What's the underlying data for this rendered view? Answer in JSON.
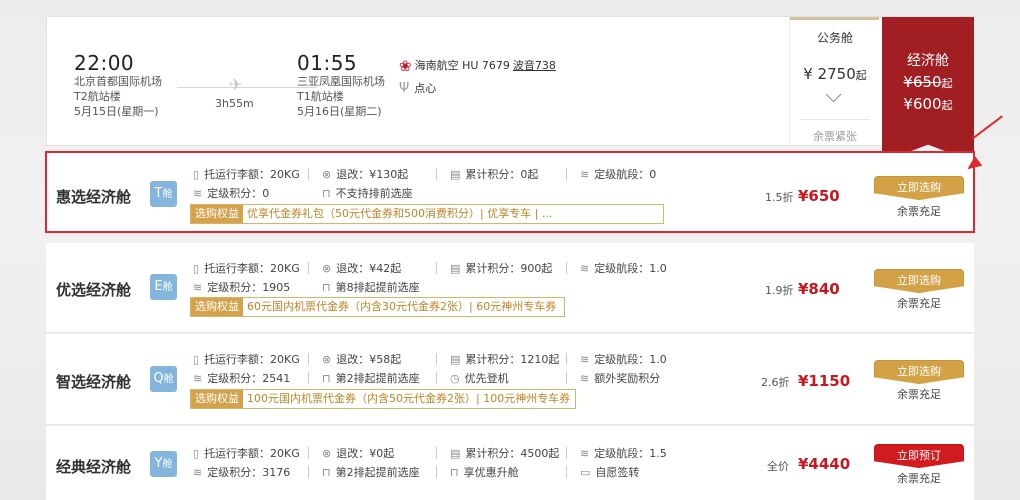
{
  "flight": {
    "dep_time": "22:00",
    "dep_airport": "北京首都国际机场",
    "dep_terminal": "T2航站楼",
    "dep_date": "5月15日(星期一)",
    "duration": "3h55m",
    "arr_time": "01:55",
    "arr_airport": "三亚凤凰国际机场",
    "arr_terminal": "T1航站楼",
    "arr_date": "5月16日(星期二)",
    "airline": "海南航空 HU 7679",
    "aircraft": "波音738",
    "meal": "点心"
  },
  "business": {
    "cabin": "公务舱",
    "price": "¥ 2750",
    "price_suffix": "起",
    "tickets": "余票紧张"
  },
  "economy": {
    "cabin": "经济舱",
    "old_price": "¥650",
    "new_price": "¥600",
    "price_suffix": "起"
  },
  "fares": [
    {
      "name": "惠选经济舱",
      "cls": "T",
      "cls_suffix": "舱",
      "baggage": "托运行李额：20KG",
      "change": "退改：¥130起",
      "points": "累计积分：0起",
      "segments": "定级航段：0",
      "level_points": "定级积分：0",
      "extra1": "不支持排前选座",
      "extra2": "",
      "extra3": "",
      "perk_tag": "选购权益",
      "perk": "优享代金券礼包（50元代金券和500消费积分）| 优享专车 | ...",
      "discount": "1.5折",
      "price": "¥650",
      "button": "立即选购",
      "seats": "余票充足"
    },
    {
      "name": "优选经济舱",
      "cls": "E",
      "cls_suffix": "舱",
      "baggage": "托运行李额：20KG",
      "change": "退改：¥42起",
      "points": "累计积分：900起",
      "segments": "定级航段：1.0",
      "level_points": "定级积分：1905",
      "extra1": "第8排起提前选座",
      "extra2": "",
      "extra3": "",
      "perk_tag": "选购权益",
      "perk": "60元国内机票代金券（内含30元代金券2张）| 60元神州专车券",
      "discount": "1.9折",
      "price": "¥840",
      "button": "立即选购",
      "seats": "余票充足"
    },
    {
      "name": "智选经济舱",
      "cls": "Q",
      "cls_suffix": "舱",
      "baggage": "托运行李额：20KG",
      "change": "退改：¥58起",
      "points": "累计积分：1210起",
      "segments": "定级航段：1.0",
      "level_points": "定级积分：2541",
      "extra1": "第2排起提前选座",
      "extra2": "优先登机",
      "extra3": "额外奖励积分",
      "perk_tag": "选购权益",
      "perk": "100元国内机票代金券（内含50元代金券2张）| 100元神州专车券",
      "discount": "2.6折",
      "price": "¥1150",
      "button": "立即选购",
      "seats": "余票充足"
    },
    {
      "name": "经典经济舱",
      "cls": "Y",
      "cls_suffix": "舱",
      "baggage": "托运行李额：20KG",
      "change": "退改：¥0起",
      "points": "累计积分：4500起",
      "segments": "定级航段：1.5",
      "level_points": "定级积分：3176",
      "extra1": "第2排起提前选座",
      "extra2": "享优惠升舱",
      "extra3": "自愿签转",
      "perk_tag": "",
      "perk": "",
      "discount": "全价",
      "price": "¥4440",
      "button": "立即预订",
      "seats": "余票充足"
    }
  ],
  "colors": {
    "brand_red": "#a11e22",
    "price_red": "#c8171f",
    "gold": "#d4a246",
    "badge_blue": "#84b5dc",
    "highlight": "#e0282e"
  }
}
